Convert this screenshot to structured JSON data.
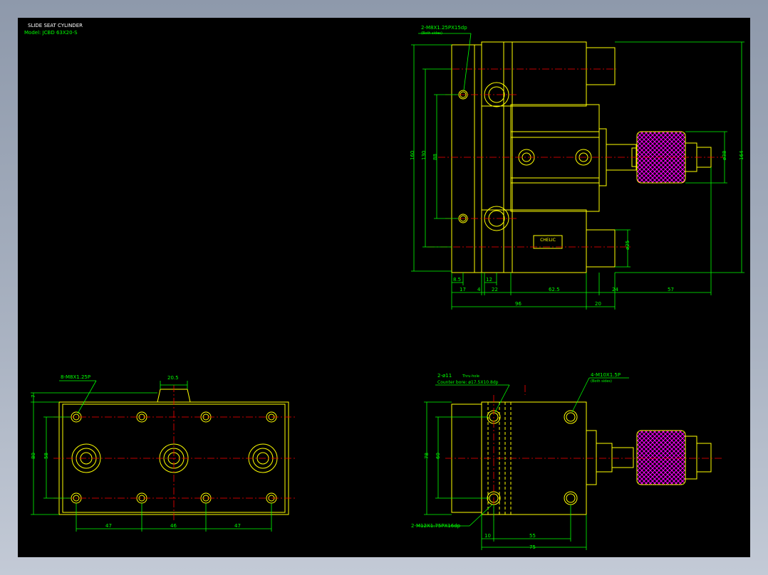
{
  "colors": {
    "background": "#000000",
    "outline": "#ffff00",
    "dimension": "#00ff00",
    "centerline": "#ff0000",
    "title": "#ffffff",
    "label": "#00ff00",
    "knob_fill": "#ff00ff"
  },
  "title_block": {
    "title": "SLIDE SEAT CYLINDER",
    "model": "Model: JCBD 63X20-S"
  },
  "top_right_view": {
    "callout_thread": "2-M8X1.25PX15dp",
    "callout_note": "(Both sides)",
    "dims_vertical": {
      "d160": "160",
      "d130": "130",
      "d88": "88",
      "d164": "164",
      "d38": "ø38",
      "d25": "ø25"
    },
    "dims_bottom_row1": {
      "d8_5": "8.5",
      "d12": "12"
    },
    "dims_bottom_row2": {
      "d17": "17",
      "d4": "4",
      "d22": "22",
      "d62_5": "62.5",
      "d24": "24",
      "d57": "57"
    },
    "dims_bottom_row3": {
      "d96": "96",
      "d20": "20"
    },
    "nameplate": "CHELIC"
  },
  "bottom_left_view": {
    "callout_thread": "8-M8X1.25P",
    "dim_top": "20.5",
    "dim_7": "7",
    "dim_80": "80",
    "dim_58": "58",
    "dims_bottom": [
      "47",
      "46",
      "47"
    ]
  },
  "bottom_right_view": {
    "callout_hole": "2-ø11",
    "callout_hole_note": "Thru-hole",
    "callout_counterbore": "Counter bore: ø17.5X10.8dp",
    "callout_thread": "4-M10X1.5P",
    "callout_thread_note": "(Both sides)",
    "callout_bottom_thread": "2-M12X1.75PX16dp",
    "dim_78": "78",
    "dim_60": "60",
    "dim_10": "10",
    "dim_55": "55",
    "dim_75": "75"
  }
}
